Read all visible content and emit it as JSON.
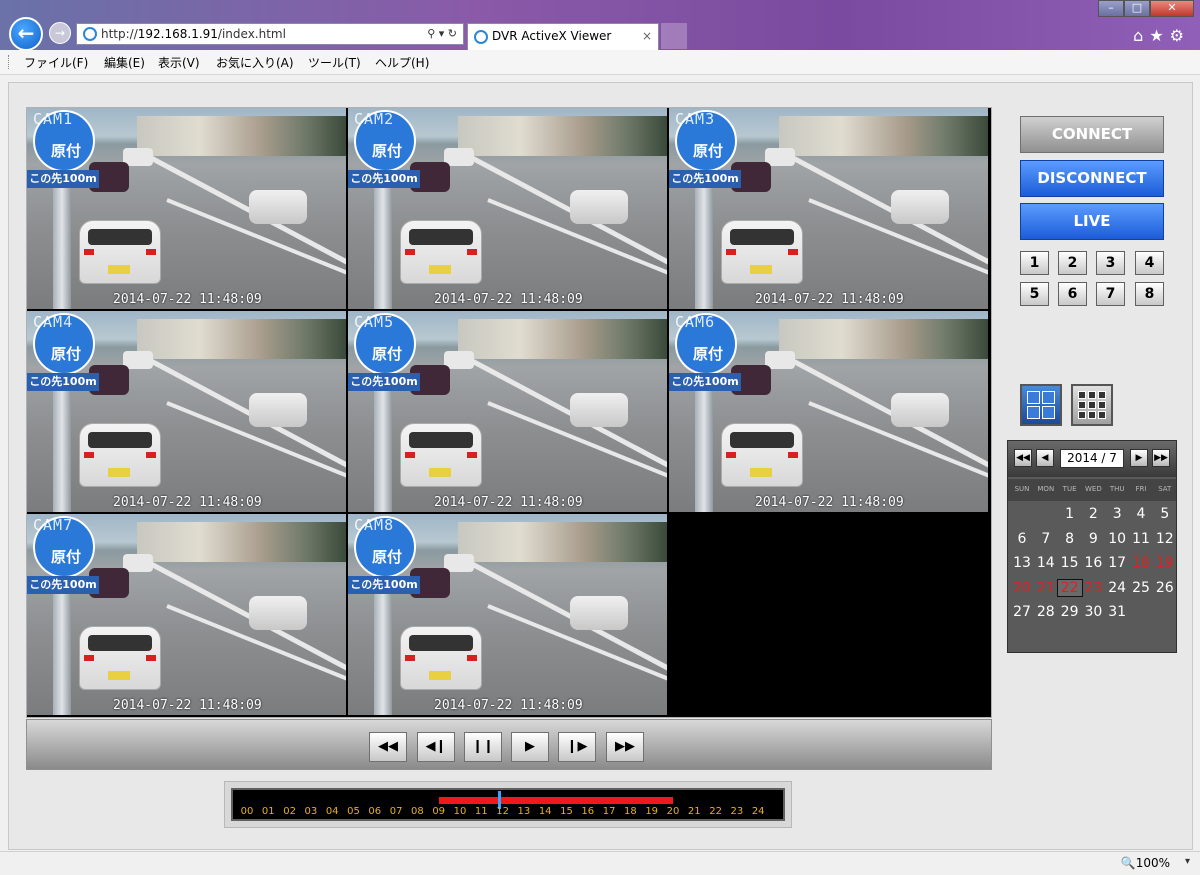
{
  "browser": {
    "url_prefix": "http://",
    "url_host": "192.168.1.91",
    "url_path": "/index.html",
    "tab_title": "DVR ActiveX Viewer",
    "tab_close": "×"
  },
  "menu": [
    "ファイル(F)",
    "編集(E)",
    "表示(V)",
    "お気に入り(A)",
    "ツール(T)",
    "ヘルプ(H)"
  ],
  "cameras": [
    {
      "label": "CAM1",
      "timestamp": "2014-07-22 11:48:09"
    },
    {
      "label": "CAM2",
      "timestamp": "2014-07-22 11:48:09"
    },
    {
      "label": "CAM3",
      "timestamp": "2014-07-22 11:48:09"
    },
    {
      "label": "CAM4",
      "timestamp": "2014-07-22 11:48:09"
    },
    {
      "label": "CAM5",
      "timestamp": "2014-07-22 11:48:09"
    },
    {
      "label": "CAM6",
      "timestamp": "2014-07-22 11:48:09"
    },
    {
      "label": "CAM7",
      "timestamp": "2014-07-22 11:48:09"
    },
    {
      "label": "CAM8",
      "timestamp": "2014-07-22 11:48:09"
    }
  ],
  "scene": {
    "sign_text": "原付",
    "plate_text": "この先100m"
  },
  "playback": [
    "◀◀",
    "◀❙",
    "❙❙",
    "▶",
    "❙▶",
    "▶▶"
  ],
  "timeline": {
    "hours": [
      "00",
      "01",
      "02",
      "03",
      "04",
      "05",
      "06",
      "07",
      "08",
      "09",
      "10",
      "11",
      "12",
      "13",
      "14",
      "15",
      "16",
      "17",
      "18",
      "19",
      "20",
      "21",
      "22",
      "23",
      "24"
    ],
    "recorded_from_hour": 9,
    "recorded_to_hour": 20,
    "cursor_hour": 11.8
  },
  "controls": {
    "connect": "CONNECT",
    "disconnect": "DISCONNECT",
    "live": "LIVE",
    "channels": [
      "1",
      "2",
      "3",
      "4",
      "5",
      "6",
      "7",
      "8"
    ]
  },
  "calendar": {
    "month_label": "2014 / 7",
    "nav": [
      "◀◀",
      "◀",
      "▶",
      "▶▶"
    ],
    "dow": [
      "SUN",
      "MON",
      "TUE",
      "WED",
      "THU",
      "FRI",
      "SAT"
    ],
    "first_dow": 2,
    "days": 31,
    "red_days": [
      18,
      19,
      20,
      21,
      22,
      23
    ],
    "selected_day": 22
  },
  "status": {
    "zoom": "100%"
  }
}
